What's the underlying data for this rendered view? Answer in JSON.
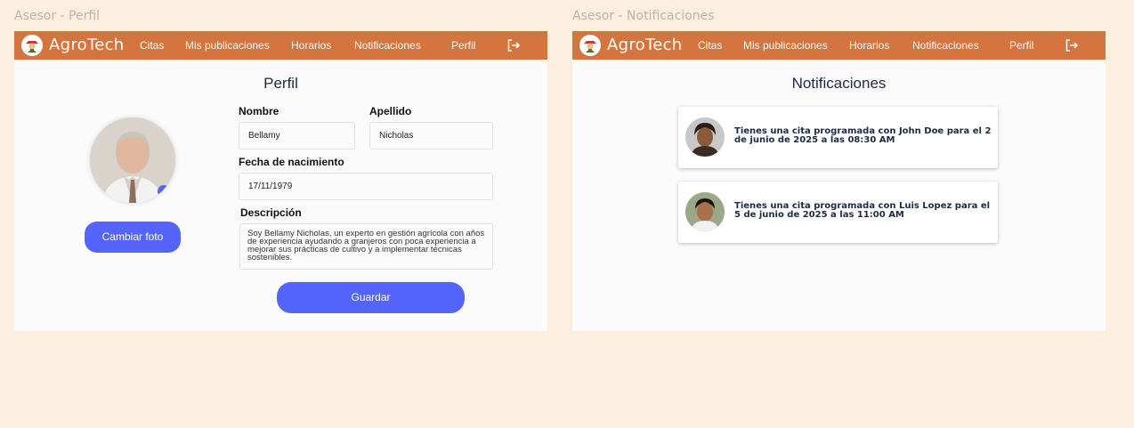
{
  "frames": {
    "perfil_title": "Asesor - Perfil",
    "notif_title": "Asesor - Notificaciones"
  },
  "nav": {
    "brand": "AgroTech",
    "items": [
      "Citas",
      "Mis publicaciones",
      "Horarios",
      "Notificaciones",
      "Perfil"
    ],
    "logout_icon": "logout-icon",
    "color": "#d4743e"
  },
  "perfil": {
    "title": "Perfil",
    "change_photo_label": "Cambiar foto",
    "nombre_label": "Nombre",
    "nombre_value": "Bellamy",
    "apellido_label": "Apellido",
    "apellido_value": "Nicholas",
    "fecha_label": "Fecha de nacimiento",
    "fecha_value": "17/11/1979",
    "descripcion_label": "Descripción",
    "descripcion_value": "Soy Bellamy Nicholas, un experto en gestión agrícola con años de experiencia ayudando a granjeros con poca experiencia a mejorar sus prácticas de cultivo y a implementar técnicas sostenibles.",
    "save_label": "Guardar",
    "button_color": "#5565fb"
  },
  "notificaciones": {
    "title": "Notificaciones",
    "items": [
      {
        "text": "Tienes una cita programada con John Doe para el 2 de junio de 2025 a las 08:30 AM"
      },
      {
        "text": "Tienes una cita programada con Luis Lopez para el 5 de junio de 2025 a las 11:00 AM"
      }
    ]
  }
}
